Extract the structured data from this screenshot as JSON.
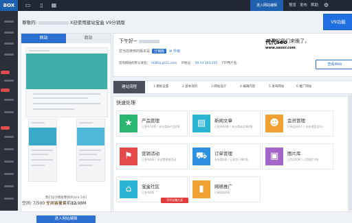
{
  "topbar": {
    "logo": "BOX",
    "icons": [
      "monitor-icon",
      "phone-icon",
      "grid-icon"
    ],
    "primary_button": "进入网站编辑",
    "links": [
      "预览",
      "发布",
      "帮助"
    ],
    "settings_icon": "gear-icon",
    "colors": {
      "bar": "#222833",
      "accent": "#1f5fb0"
    }
  },
  "welcome": {
    "prefix": "尊敬的:",
    "suffix": "X迎使用建站宝盒 V9分销版"
  },
  "left_panel": {
    "tabs": [
      "网站",
      "商站"
    ],
    "rating_text": "我们设计模板整体评分(4.5分)",
    "stars": "★★★★★",
    "rating_count": "已有",
    "enter_button": "进入网站编辑",
    "storage": "空间: 7/500 空间容量目前32.98M"
  },
  "main_card": {
    "greeting": "下午好~",
    "sorry_text": "对不起我们来晚了，",
    "sorry_highlight": "",
    "version_label": "您当前使用的版本是",
    "version_badge": "分销版",
    "upgrade_label": "升级",
    "info": {
      "domain_label": "您的网站的默认域名:",
      "domain_value": "hk8Eq.gs51.com",
      "ip_label": "IP地址:",
      "ip_value": "59.54.163.205",
      "ftp_label": "FTP用户名:",
      "ftp_value": ""
    },
    "view_button": "查看Web",
    "v9_button": "V9功能"
  },
  "watermark": {
    "title": "代代seo",
    "sub": "www.seoxr.com"
  },
  "steps": {
    "first": "建站流程",
    "items": [
      "1 模板设置",
      "2 基本资料",
      "3 网站设计",
      "4 编辑内容",
      "5 发布网站",
      "6 推广网站"
    ]
  },
  "quick": {
    "title": "快速处理",
    "tiles": [
      {
        "name": "产品管理",
        "desc": "已发布10条 / 未分类新产品0条",
        "icon": "star-icon",
        "color": "#2ab66e"
      },
      {
        "name": "新闻文章",
        "desc": "已发布60条 / 未分类新文章0条",
        "icon": "newspaper-icon",
        "color": "#2bb4d4"
      },
      {
        "name": "会员管理",
        "desc": "已有会员0人 / 未处理会员0人",
        "icon": "user-icon",
        "color": "#f0a132"
      },
      {
        "name": "营销活动",
        "desc": "已发布0条 / 未设置营销活动",
        "icon": "flag-icon",
        "color": "#e44a4a"
      },
      {
        "name": "订单管理",
        "desc": "未处理0条 / 已发货订单0条",
        "icon": "cart-icon",
        "color": "#2c8fe0"
      },
      {
        "name": "图片库",
        "desc": "已用100M / 已用图片0张",
        "icon": "image-icon",
        "color": "#a466c9"
      },
      {
        "name": "宝盒社区",
        "desc": "已发布0条",
        "icon": "house-icon",
        "color": "#2bb4d4"
      },
      {
        "name": "网络推广",
        "desc": "已有网站0条",
        "icon": "chart-icon",
        "color": "#f0a132"
      }
    ],
    "fix_button": "写评论赚大奖"
  }
}
